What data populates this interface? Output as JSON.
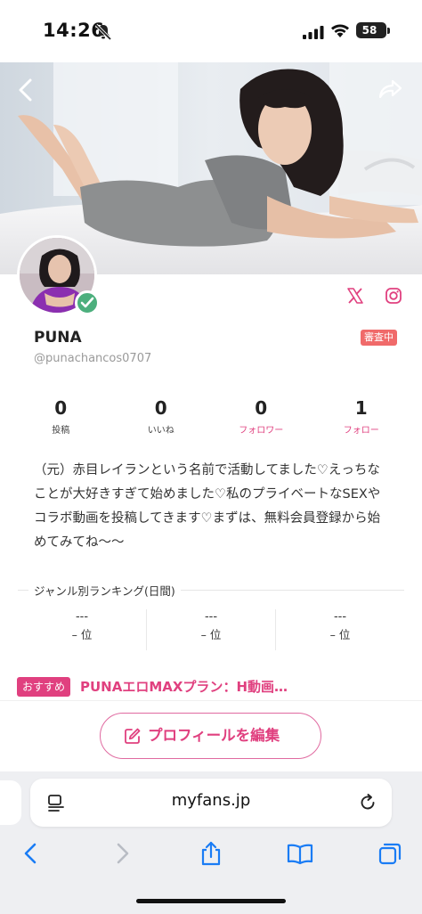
{
  "status_bar": {
    "time": "14:26",
    "battery": "58",
    "battery_level": 0.58
  },
  "profile": {
    "name": "PUNA",
    "handle": "@punachancos0707",
    "review_badge": "審査中",
    "verified": true
  },
  "stats": [
    {
      "value": "0",
      "label": "投稿",
      "accent": false
    },
    {
      "value": "0",
      "label": "いいね",
      "accent": false
    },
    {
      "value": "0",
      "label": "フォロワー",
      "accent": true
    },
    {
      "value": "1",
      "label": "フォロー",
      "accent": true
    }
  ],
  "bio": {
    "line1": "（元）赤目レイランという名前で活動してました♡えっちな",
    "line2": "ことが大好きすぎて始めました♡私のプライベートなSEXや",
    "line3": "コラボ動画を投稿してきます♡まずは、無料会員登録から始",
    "line4": "めてみてね〜〜"
  },
  "ranking": {
    "title": "ジャンル別ランキング(日間)",
    "cells": [
      {
        "dash": "---",
        "pos": "– 位"
      },
      {
        "dash": "---",
        "pos": "– 位"
      },
      {
        "dash": "---",
        "pos": "– 位"
      }
    ]
  },
  "recommend": {
    "badge": "おすすめ",
    "title": "PUNAエロMAXプラン：H動画…"
  },
  "edit_button": {
    "label": "プロフィールを編集"
  },
  "browser": {
    "url": "myfans.jp"
  },
  "colors": {
    "accent_pink": "#e0407f",
    "badge_red": "#f06a6a",
    "verified_green": "#4caf7d",
    "ios_blue": "#1a7cf5"
  },
  "icons": [
    "bell-slash-icon",
    "signal-icon",
    "wifi-icon",
    "battery-icon",
    "back-arrow-icon",
    "share-icon",
    "x-logo-icon",
    "instagram-icon",
    "check-icon",
    "edit-icon",
    "reader-icon",
    "reload-icon",
    "back-icon",
    "forward-icon",
    "share-up-icon",
    "bookmarks-icon",
    "tabs-icon"
  ]
}
